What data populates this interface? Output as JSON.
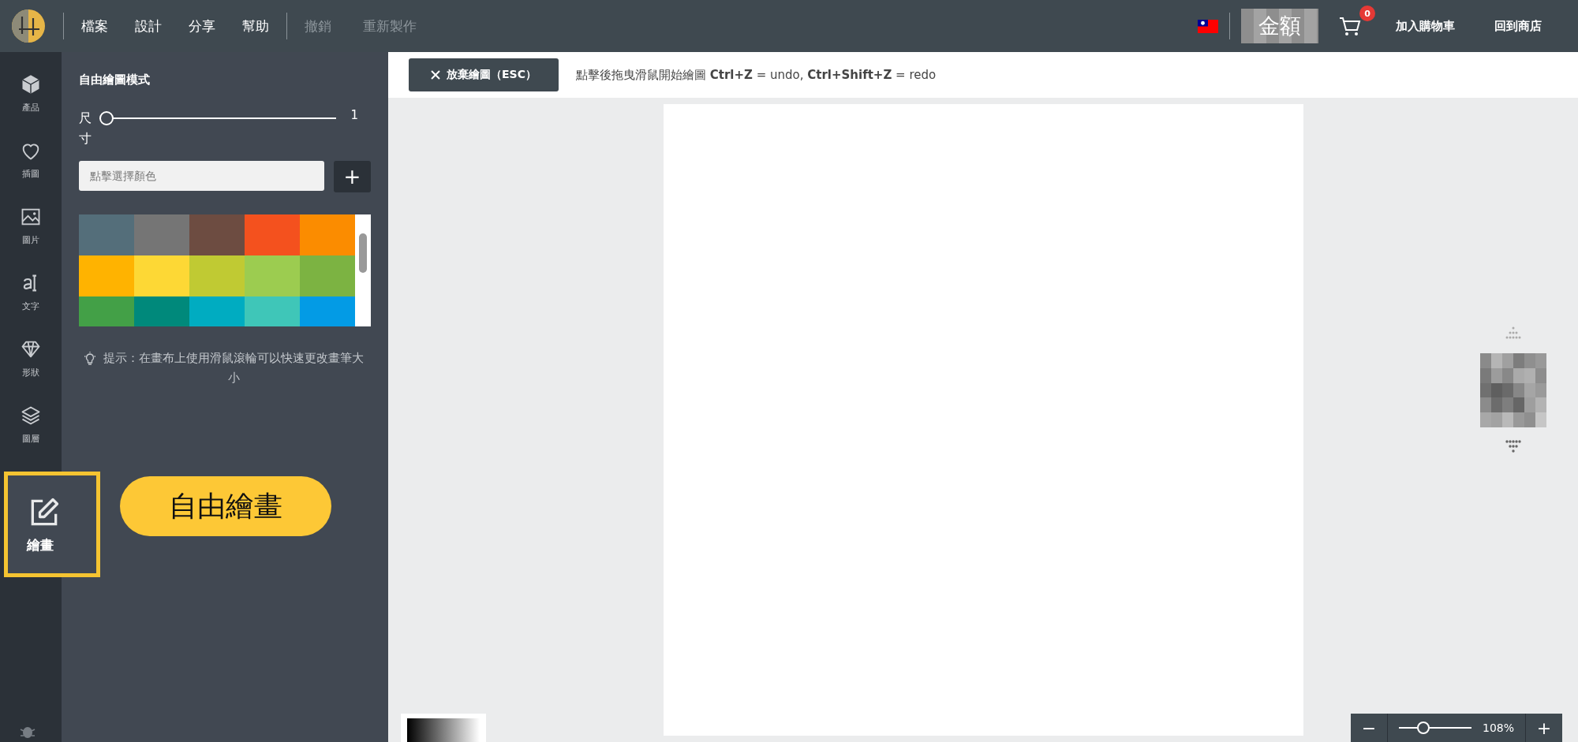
{
  "top_bar": {
    "menu": [
      {
        "label": "檔案",
        "disabled": false
      },
      {
        "label": "設計",
        "disabled": false
      },
      {
        "label": "分享",
        "disabled": false
      },
      {
        "label": "幫助",
        "disabled": false
      },
      {
        "label": "撤銷",
        "disabled": true
      },
      {
        "label": "重新製作",
        "disabled": true
      }
    ],
    "amount": "金額",
    "cart_count": "0",
    "add_to_cart": "加入購物車",
    "back_to_shop": "回到商店"
  },
  "sidebar": {
    "items": [
      {
        "kind": "cube",
        "label": "產品",
        "selected": false
      },
      {
        "kind": "heart",
        "label": "插圖",
        "selected": false
      },
      {
        "kind": "image",
        "label": "圖片",
        "selected": false
      },
      {
        "kind": "text",
        "label": "文字",
        "selected": false
      },
      {
        "kind": "diamond",
        "label": "形狀",
        "selected": false
      },
      {
        "kind": "layers",
        "label": "圖層",
        "selected": false
      },
      {
        "kind": "draw",
        "label": "繪畫",
        "selected": true
      }
    ]
  },
  "panel": {
    "title": "自由繪圖模式",
    "size_label": "尺寸",
    "size": {
      "level": 0,
      "reading": "1"
    },
    "color_field": {
      "placeholder": "點擊選擇顏色"
    },
    "add_button": "+",
    "swatches": [
      {
        "color": "#546e7a"
      },
      {
        "color": "#757575"
      },
      {
        "color": "#6d4c41"
      },
      {
        "color": "#f4511e"
      },
      {
        "color": "#fb8c00"
      },
      {
        "color": "#ffb300"
      },
      {
        "color": "#fdd835"
      },
      {
        "color": "#c0ca33"
      },
      {
        "color": "#9ccc50"
      },
      {
        "color": "#7cb342"
      },
      {
        "color": "#43a047"
      },
      {
        "color": "#00897b"
      },
      {
        "color": "#00acc1"
      },
      {
        "color": "#3fc6b8"
      },
      {
        "color": "#039be5"
      }
    ],
    "hint": "提示：在畫布上使用滑鼠滾輪可以快速更改畫筆大小"
  },
  "callout": "自由繪畫",
  "toolbar": {
    "discard_button": "放棄繪圖（ESC）",
    "instruction": "點擊後拖曳滑鼠開始繪圖 **Ctrl+Z** = undo, **Ctrl+Shift+Z** = redo"
  },
  "zoom": {
    "minus": "−",
    "level": 0.3,
    "reading": "108%",
    "plus": "+"
  }
}
